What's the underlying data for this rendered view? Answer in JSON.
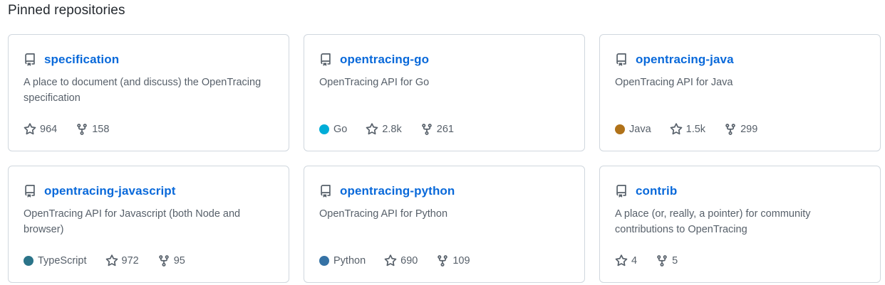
{
  "section": {
    "title": "Pinned repositories"
  },
  "repos": [
    {
      "name": "specification",
      "description": "A place to document (and discuss) the OpenTracing specification",
      "language": "",
      "language_color": "",
      "stars": "964",
      "forks": "158"
    },
    {
      "name": "opentracing-go",
      "description": "OpenTracing API for Go",
      "language": "Go",
      "language_color": "#00ADD8",
      "stars": "2.8k",
      "forks": "261"
    },
    {
      "name": "opentracing-java",
      "description": "OpenTracing API for Java",
      "language": "Java",
      "language_color": "#b07219",
      "stars": "1.5k",
      "forks": "299"
    },
    {
      "name": "opentracing-javascript",
      "description": "OpenTracing API for Javascript (both Node and browser)",
      "language": "TypeScript",
      "language_color": "#2b7489",
      "stars": "972",
      "forks": "95"
    },
    {
      "name": "opentracing-python",
      "description": "OpenTracing API for Python",
      "language": "Python",
      "language_color": "#3572A5",
      "stars": "690",
      "forks": "109"
    },
    {
      "name": "contrib",
      "description": "A place (or, really, a pointer) for community contributions to OpenTracing",
      "language": "",
      "language_color": "",
      "stars": "4",
      "forks": "5"
    }
  ],
  "icons": {
    "repo": "repo-icon",
    "star": "star-icon",
    "fork": "fork-icon"
  }
}
